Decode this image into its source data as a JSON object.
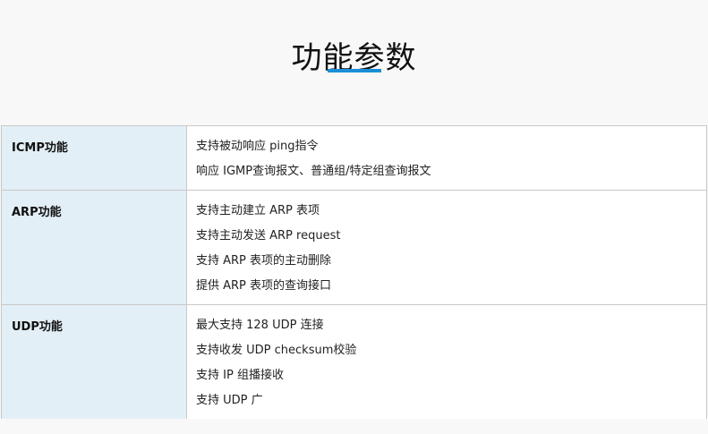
{
  "header": {
    "title": "功能参数"
  },
  "colors": {
    "accent": "#1a8fd8",
    "label_bg": "#e3eff6",
    "border": "#c8c8c8",
    "page_bg": "#f8f8f8"
  },
  "rows": [
    {
      "label": "ICMP功能",
      "items": [
        "支持被动响应 ping指令",
        "响应 IGMP查询报文、普通组/特定组查询报文"
      ]
    },
    {
      "label": "ARP功能",
      "items": [
        "支持主动建立 ARP 表项",
        "支持主动发送 ARP request",
        "支持 ARP 表项的主动删除",
        "提供 ARP 表项的查询接口"
      ]
    },
    {
      "label": "UDP功能",
      "items": [
        "最大支持 128 UDP 连接",
        "支持收发 UDP checksum校验",
        "支持 IP 组播接收",
        "支持 UDP 广"
      ]
    }
  ]
}
